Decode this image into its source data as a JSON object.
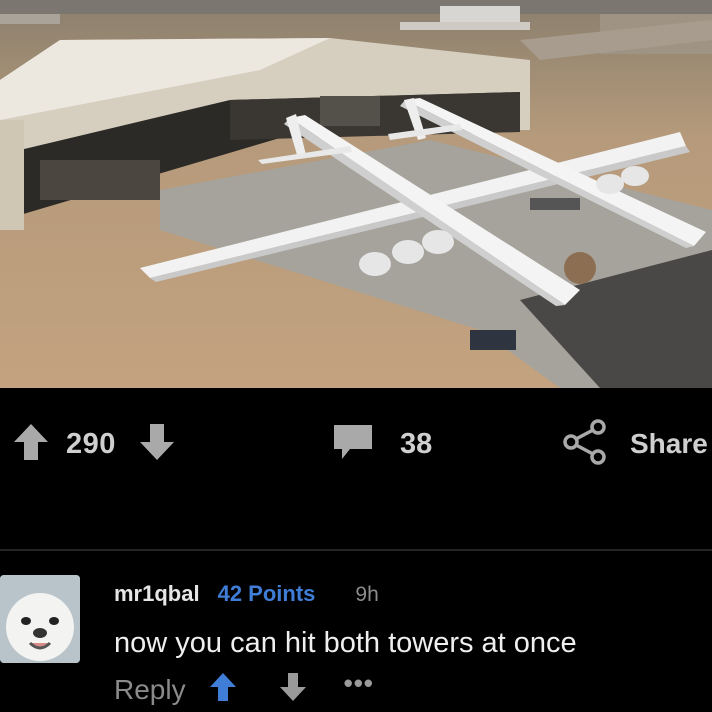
{
  "post": {
    "image_alt": "aerial photo of a very wide twin-fuselage aircraft parked in front of a hangar",
    "upvote_count": "290",
    "comment_count": "38",
    "share_label": "Share"
  },
  "comment": {
    "username": "mr1qbal",
    "points": "42 Points",
    "timestamp": "9h",
    "body": "now you can hit both towers at once",
    "reply_label": "Reply",
    "more_label": "•••"
  },
  "colors": {
    "background": "#000000",
    "points_accent": "#3f7dd6",
    "upvote_active": "#3f7dd6",
    "text_primary": "#efefef",
    "text_muted": "#8a8a8a"
  },
  "icons": {
    "upvote": "arrow-up-icon",
    "downvote": "arrow-down-icon",
    "comments": "speech-bubble-icon",
    "share": "share-icon",
    "more": "more-dots-icon"
  }
}
